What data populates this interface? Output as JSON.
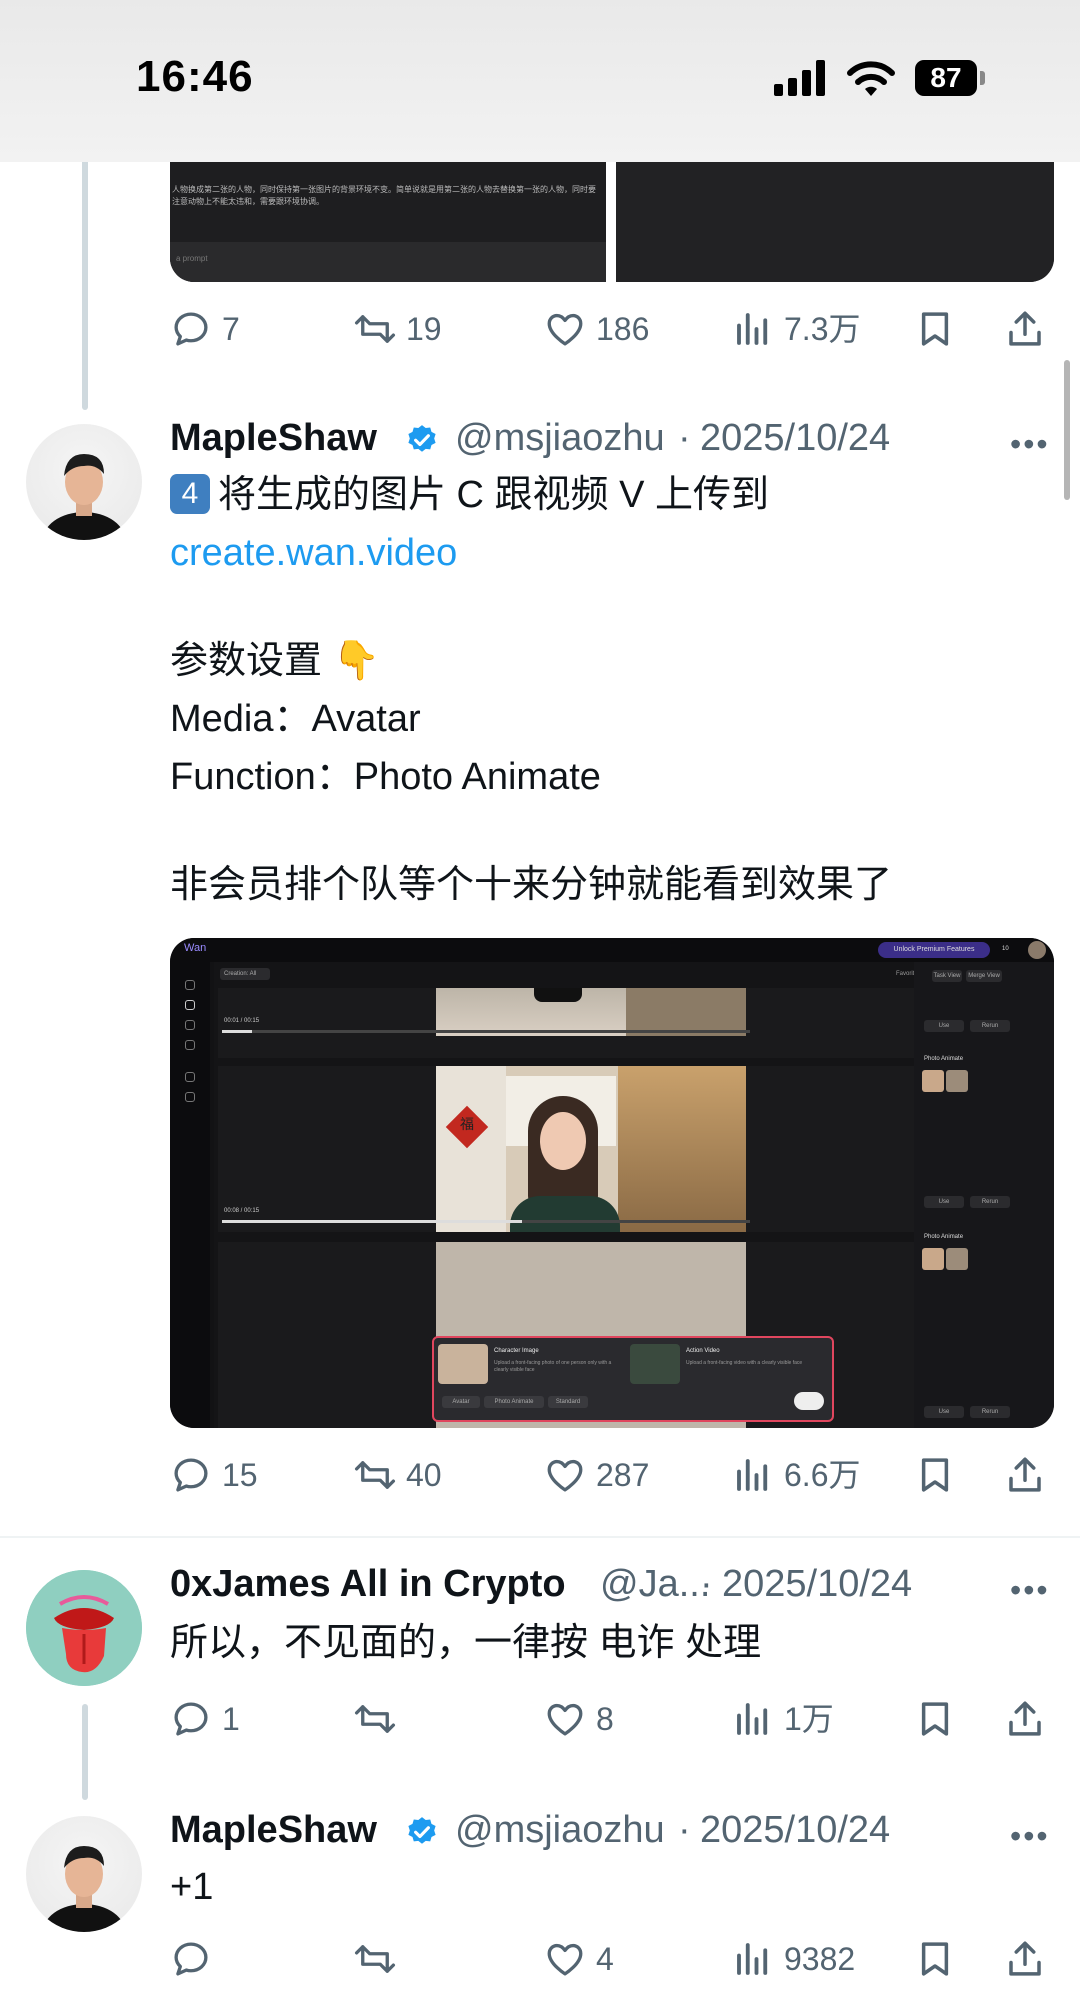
{
  "status_bar": {
    "time": "16:46",
    "battery": "87"
  },
  "colors": {
    "link": "#1d9bf0",
    "verified": "#1d9bf0",
    "muted": "#536471",
    "thread_line": "#cfd9de"
  },
  "top_card": {
    "caption": "人物换成第二张的人物，同时保持第一张图片的背景环境不变。简单说就是用第二张的人物去替换第一张的人物，同时要注意动物上不能太违和，需要跟环境协调。",
    "input_placeholder": "a prompt",
    "actions": {
      "replies": "7",
      "reposts": "19",
      "likes": "186",
      "views": "7.3万"
    }
  },
  "tweet_main": {
    "name": "MapleShaw",
    "handle": "@msjiaozhu",
    "separator": "·",
    "date": "2025/10/24",
    "more": "•••",
    "keycap": "4",
    "line1": "将生成的图片 C 跟视频 V 上传到",
    "link": "create.wan.video",
    "line_params": "参数设置 👇",
    "line_media": "Media：Avatar",
    "line_function": "Function：Photo Animate",
    "line_wait": "非会员排个队等个十来分钟就能看到效果了",
    "screenshot": {
      "logo": "Wan",
      "unlock": "Unlock Premium Features",
      "credits": "10",
      "filter": "Creation: All",
      "favorite": "Favorite",
      "task_view": "Task View",
      "merge_view": "Merge View",
      "time1": "00:01 / 00:15",
      "time2": "00:08 / 00:15",
      "use": "Use",
      "rerun": "Rerun",
      "panel_title": "Photo Animate",
      "fu": "福",
      "popup_char_title": "Character Image",
      "popup_char_desc": "Upload a front-facing photo of one person only with a clearly visible face",
      "popup_action_title": "Action Video",
      "popup_action_desc": "Upload a front-facing video with a clearly visible face",
      "popup_tab1": "Avatar",
      "popup_tab2": "Photo Animate",
      "popup_tab3": "Standard"
    },
    "actions": {
      "replies": "15",
      "reposts": "40",
      "likes": "287",
      "views": "6.6万"
    }
  },
  "reply_james": {
    "name": "0xJames All in Crypto",
    "handle": "@Ja...",
    "separator": "·",
    "date": "2025/10/24",
    "more": "•••",
    "text": "所以，不见面的，一律按 电诈 处理",
    "actions": {
      "replies": "1",
      "reposts": "",
      "likes": "8",
      "views": "1万"
    }
  },
  "reply_maple": {
    "name": "MapleShaw",
    "handle": "@msjiaozhu",
    "separator": "·",
    "date": "2025/10/24",
    "more": "•••",
    "text": "+1",
    "actions": {
      "replies": "",
      "reposts": "",
      "likes": "4",
      "views": "9382"
    }
  }
}
